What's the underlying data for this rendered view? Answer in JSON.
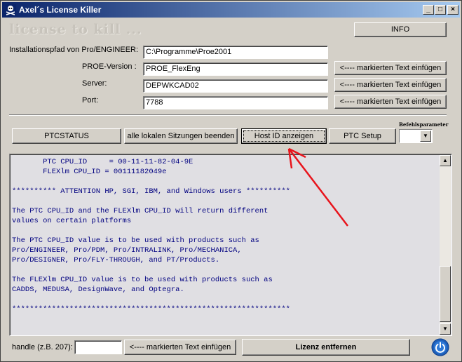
{
  "window": {
    "title": "Axel´s License Killer",
    "controls": [
      "_",
      "□",
      "×"
    ]
  },
  "header": {
    "watermark": "license to kill ...",
    "info_label": "INFO"
  },
  "form": {
    "install_path_label": "Installationspfad von Pro/ENGINEER:",
    "install_path_value": "C:\\Programme\\Proe2001",
    "proe_version_label": "PROE-Version :",
    "proe_version_value": "PROE_FlexEng",
    "server_label": "Server:",
    "server_value": "DEPWKCAD02",
    "port_label": "Port:",
    "port_value": "7788",
    "insert_label": "<---- markierten Text einfügen"
  },
  "toolbar": {
    "ptcstatus_label": "PTCSTATUS",
    "end_sessions_label": "alle lokalen Sitzungen beenden",
    "host_id_label": "Host ID anzeigen",
    "ptc_setup_label": "PTC Setup",
    "params_label": "Befehlsparameter"
  },
  "output": {
    "text": "       PTC CPU_ID     = 00-11-11-82-04-9E\n       FLEXlm CPU_ID = 00111182049e\n\n********** ATTENTION HP, SGI, IBM, and Windows users **********\n\nThe PTC CPU_ID and the FLEXlm CPU_ID will return different\nvalues on certain platforms\n\nThe PTC CPU_ID value is to be used with products such as\nPro/ENGINEER, Pro/PDM, Pro/INTRALINK, Pro/MECHANICA,\nPro/DESIGNER, Pro/FLY-THROUGH, and PT/Products.\n\nThe FLEXlm CPU_ID value is to be used with products such as\nCADDS, MEDUSA, DesignWave, and Optegra.\n\n***************************************************************"
  },
  "footer": {
    "handle_label": "handle (z.B. 207):",
    "handle_value": "",
    "insert_label": "<----  markierten Text einfügen",
    "remove_label": "Lizenz entfernen"
  },
  "colors": {
    "title_start": "#0a246a",
    "title_end": "#a6caf0",
    "output_text": "#000080",
    "annotation_arrow": "#e8141c",
    "power_icon": "#1f5fb8"
  }
}
